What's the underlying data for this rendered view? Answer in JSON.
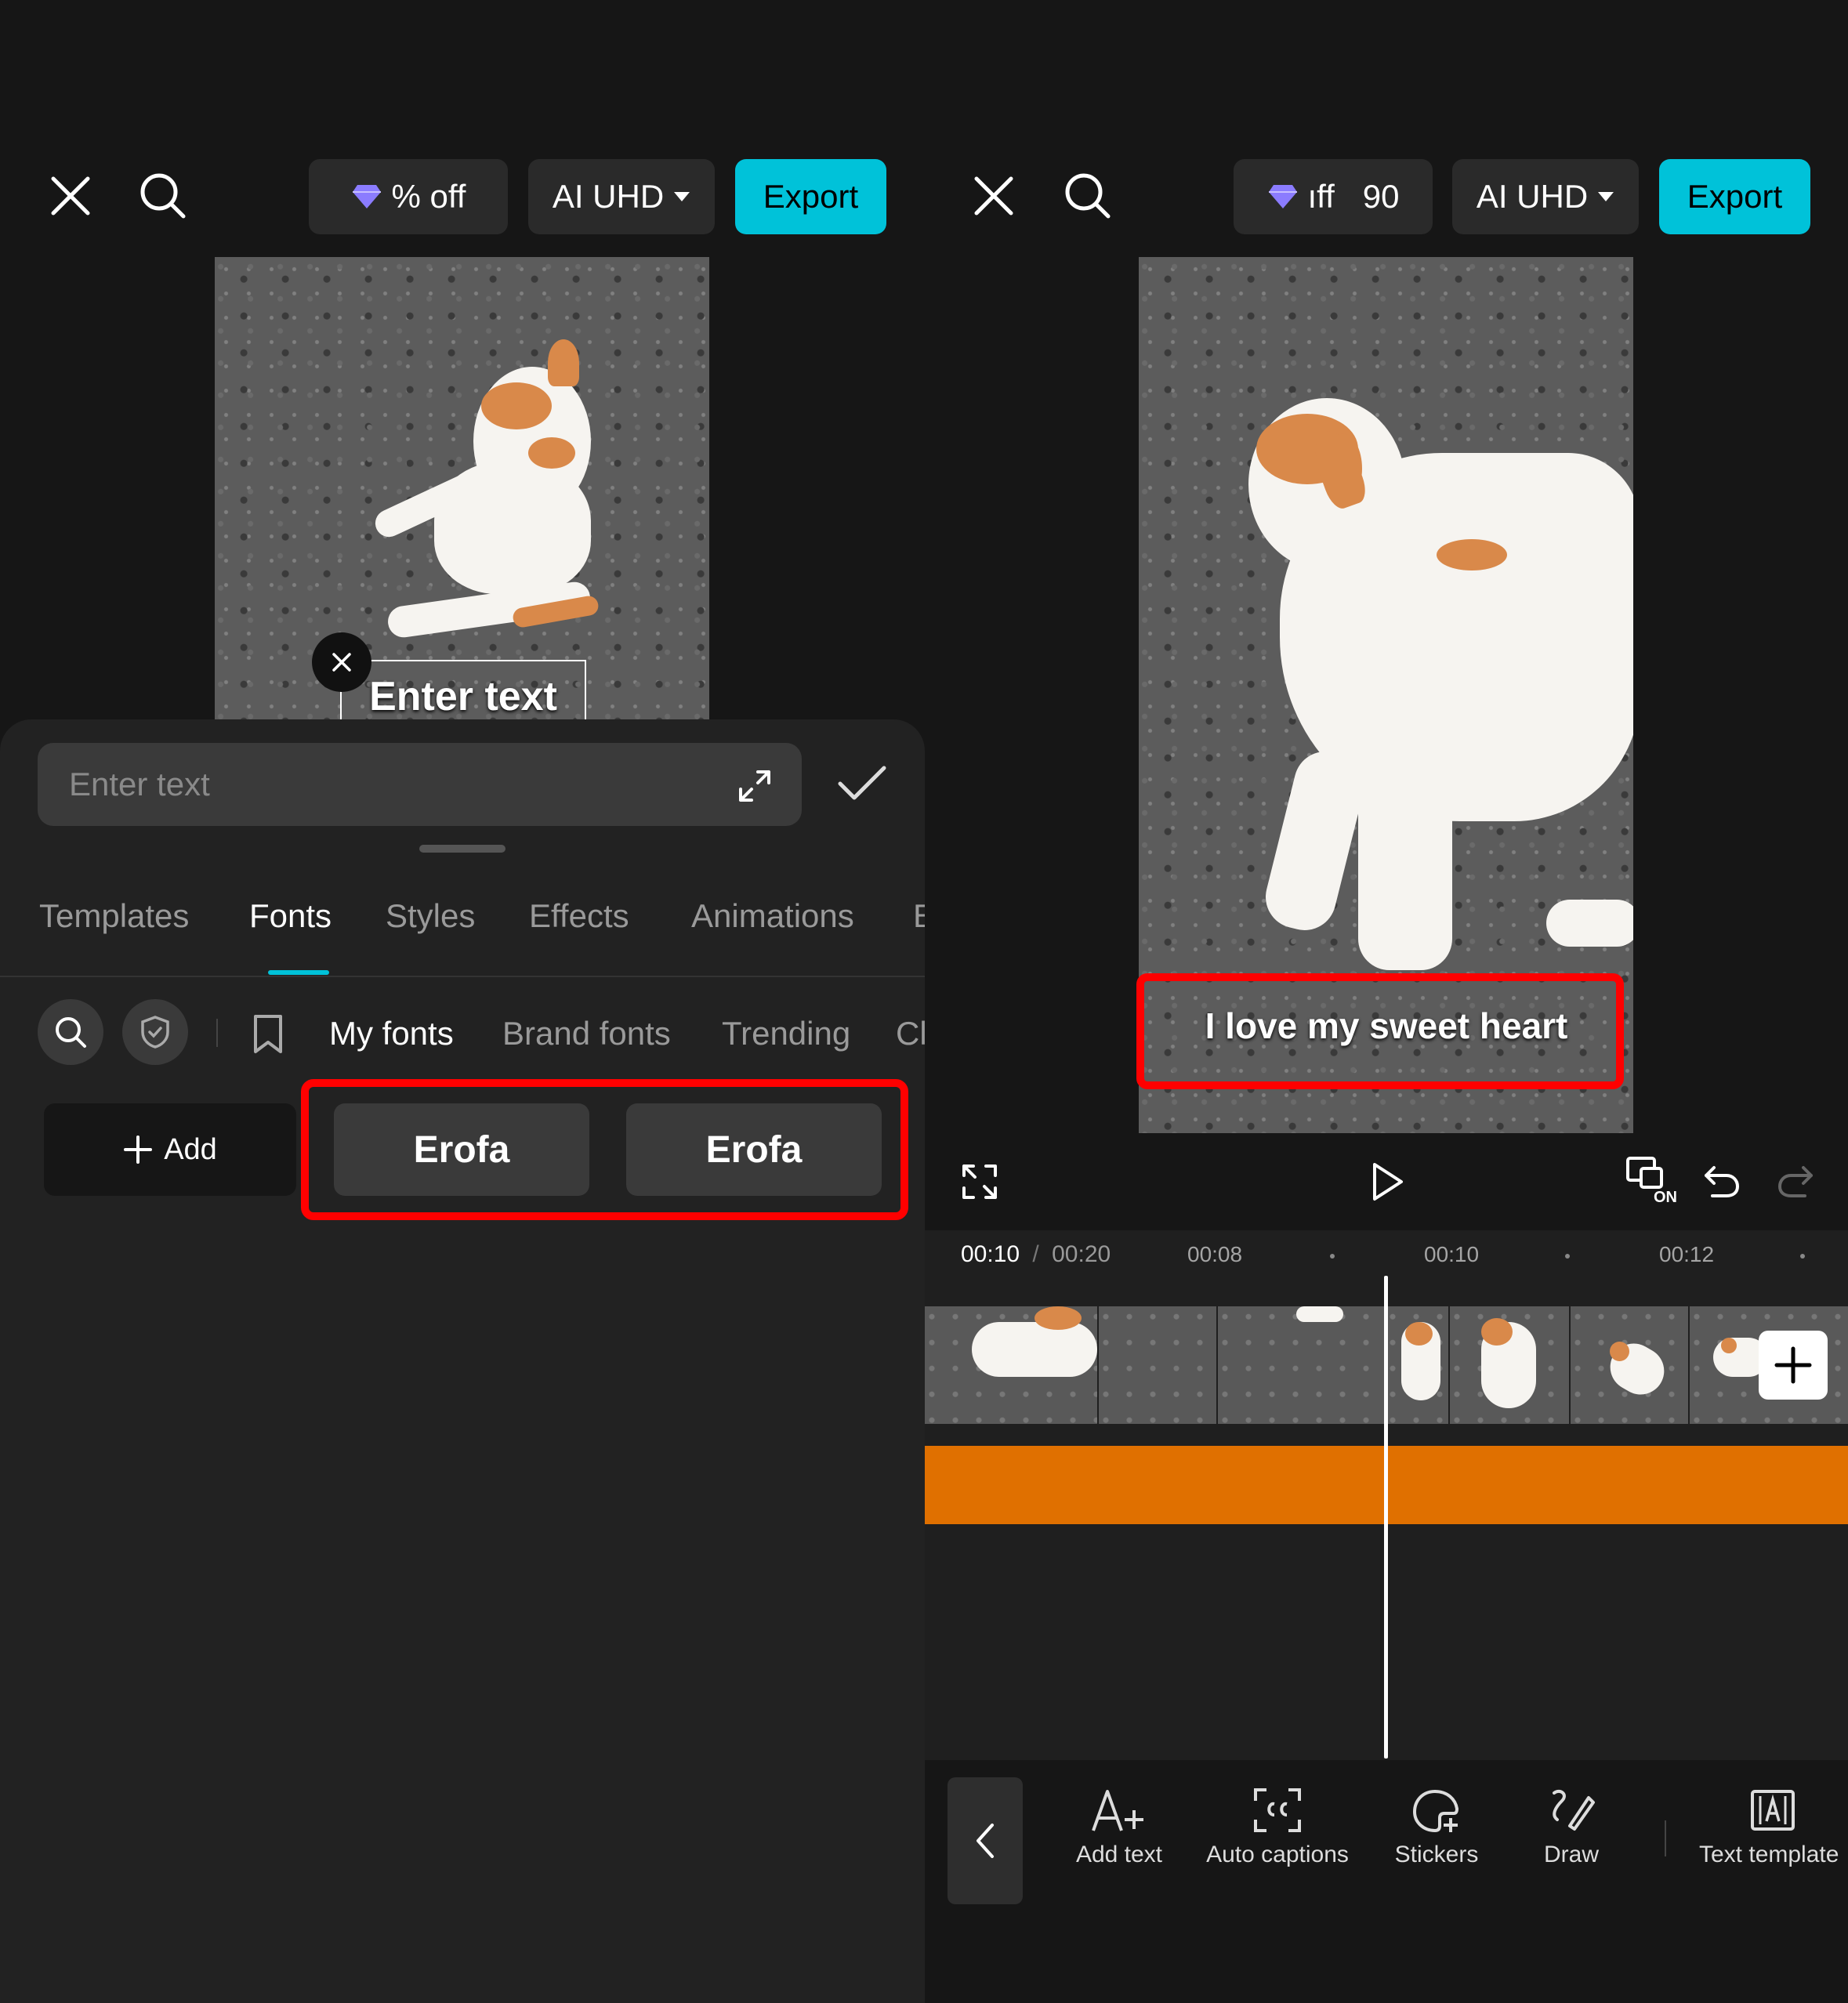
{
  "left": {
    "header": {
      "promo_label": "% off",
      "quality_label": "AI UHD",
      "export_label": "Export"
    },
    "preview": {
      "overlay_text": "Enter text"
    },
    "editor": {
      "input_placeholder": "Enter text",
      "tabs": [
        "Templates",
        "Fonts",
        "Styles",
        "Effects",
        "Animations",
        "E"
      ],
      "active_tab": "Fonts",
      "font_categories": [
        "My fonts",
        "Brand fonts",
        "Trending",
        "Cl"
      ],
      "add_label": "Add",
      "font_cards": [
        "Erofa",
        "Erofa"
      ]
    }
  },
  "right": {
    "header": {
      "promo_label": "ıff",
      "promo_count": "90",
      "quality_label": "AI UHD",
      "export_label": "Export"
    },
    "preview": {
      "caption_text": "I love my sweet heart"
    },
    "playback": {
      "current_time": "00:10",
      "separator": "/",
      "total_time": "00:20"
    },
    "ruler_marks": [
      "00:08",
      "00:10",
      "00:12"
    ],
    "tools": [
      "Add text",
      "Auto captions",
      "Stickers",
      "Draw",
      "Text template"
    ],
    "captions_toggle": "ON"
  },
  "colors": {
    "accent": "#00c2d9",
    "highlight": "#ff0000",
    "text_track": "#e07000",
    "gem": "#8b7cff"
  },
  "icons": [
    "close-icon",
    "search-icon",
    "gem-icon",
    "chevron-down-icon",
    "expand-icon",
    "check-icon",
    "shield-icon",
    "bookmark-icon",
    "plus-icon",
    "fullscreen-icon",
    "play-icon",
    "captions-toggle-icon",
    "undo-icon",
    "redo-icon",
    "back-chevron-icon",
    "add-text-icon",
    "auto-captions-icon",
    "stickers-icon",
    "draw-icon",
    "text-template-icon"
  ]
}
